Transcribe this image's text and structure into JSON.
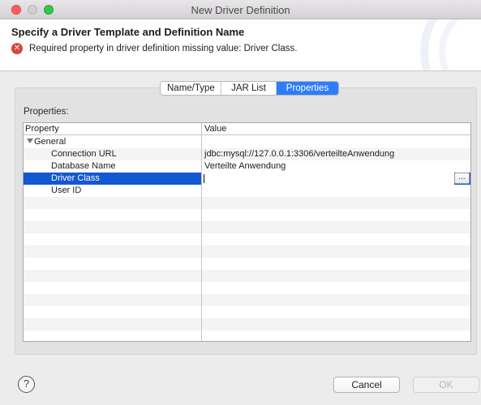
{
  "window": {
    "title": "New Driver Definition"
  },
  "header": {
    "title": "Specify a Driver Template and Definition Name",
    "error_message": "Required property in driver definition missing value: Driver Class."
  },
  "tabs": [
    {
      "label": "Name/Type",
      "active": false
    },
    {
      "label": "JAR List",
      "active": false
    },
    {
      "label": "Properties",
      "active": true
    }
  ],
  "properties": {
    "label": "Properties:",
    "columns": [
      "Property",
      "Value"
    ],
    "group": "General",
    "rows": [
      {
        "property": "Connection URL",
        "value": "jdbc:mysql://127.0.0.1:3306/verteilteAnwendung"
      },
      {
        "property": "Database Name",
        "value": "Verteilte Anwendung"
      },
      {
        "property": "Driver Class",
        "value": "",
        "selected": true
      },
      {
        "property": "User ID",
        "value": ""
      }
    ],
    "ellipsis_label": "..."
  },
  "buttons": {
    "help": "?",
    "cancel": "Cancel",
    "ok": "OK"
  },
  "colors": {
    "accent": "#2e7df6",
    "selection": "#1358d0",
    "error": "#d9453e"
  }
}
